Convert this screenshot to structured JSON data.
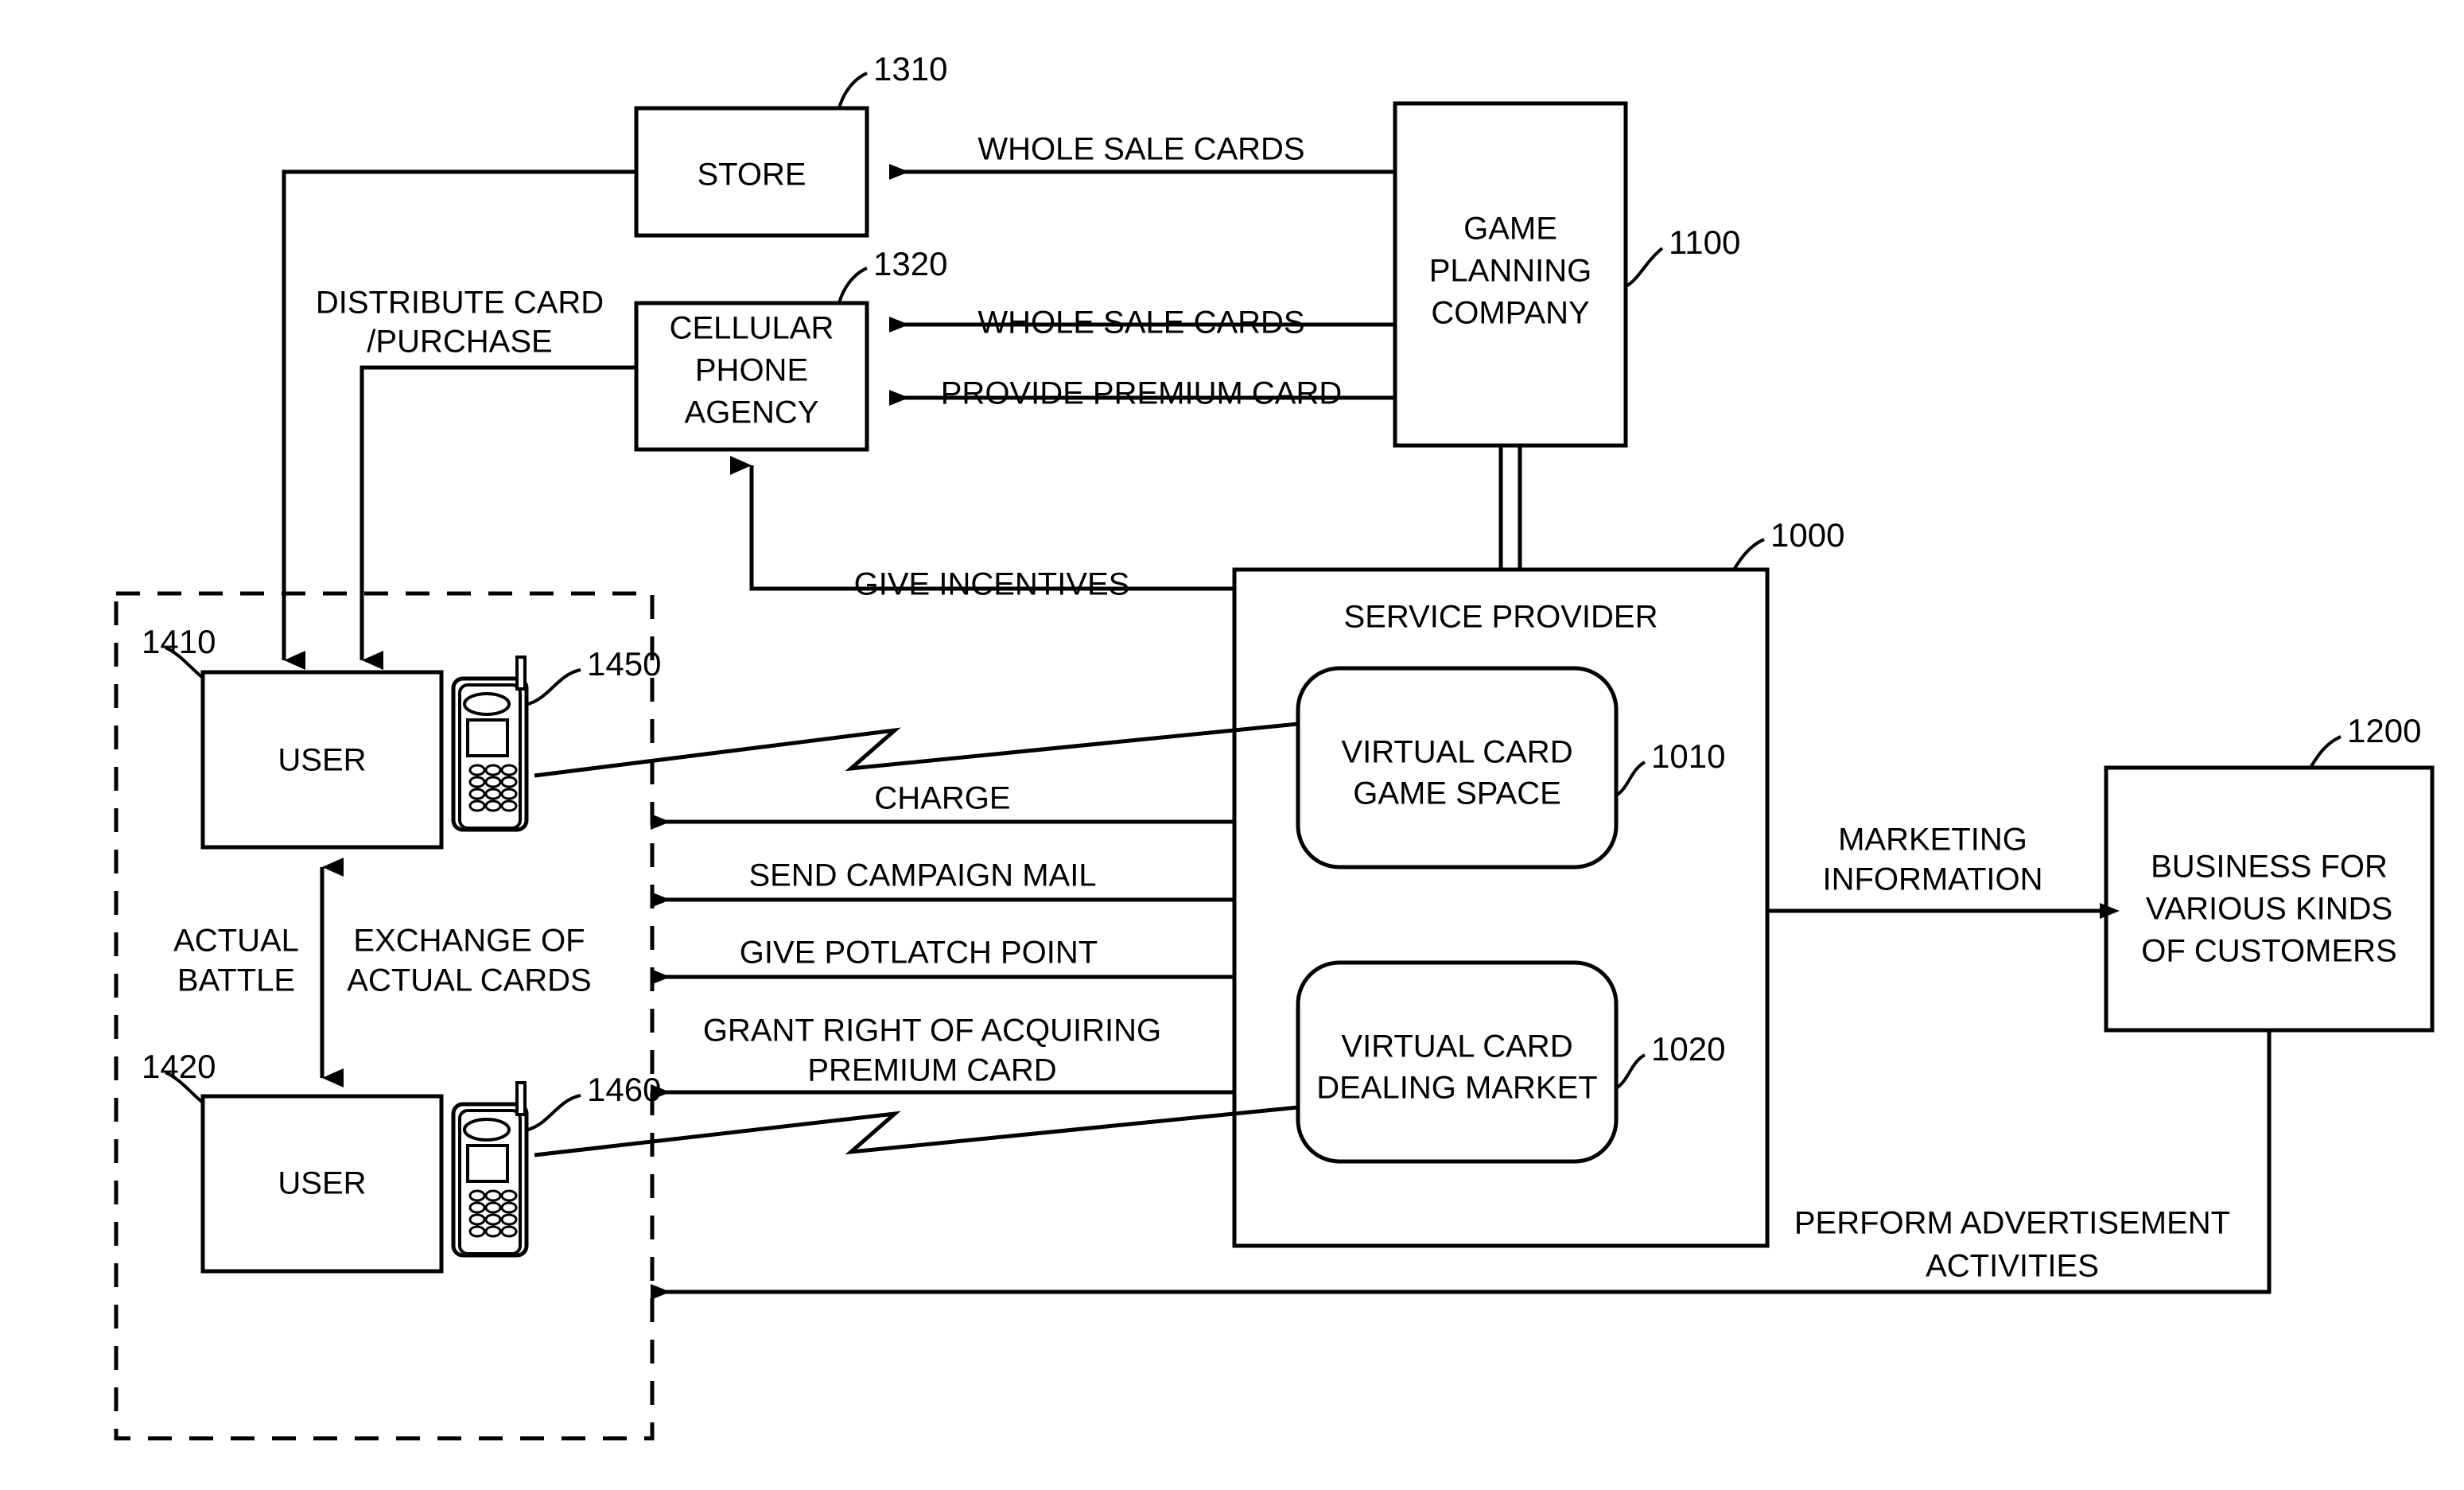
{
  "figure": {
    "type": "patent-block-diagram",
    "background": "#ffffff",
    "stroke_color": "#000000"
  },
  "boxes": {
    "store": {
      "label": "STORE",
      "ref": "1310"
    },
    "cellular_phone_agency": {
      "line1": "CELLULAR",
      "line2": "PHONE",
      "line3": "AGENCY",
      "ref": "1320"
    },
    "game_planning_company": {
      "line1": "GAME",
      "line2": "PLANNING",
      "line3": "COMPANY",
      "ref": "1100"
    },
    "service_provider": {
      "label": "SERVICE PROVIDER",
      "ref": "1000"
    },
    "virtual_card_game_space": {
      "line1": "VIRTUAL CARD",
      "line2": "GAME SPACE",
      "ref": "1010"
    },
    "virtual_card_dealing_market": {
      "line1": "VIRTUAL CARD",
      "line2": "DEALING MARKET",
      "ref": "1020"
    },
    "business_customers": {
      "line1": "BUSINESS FOR",
      "line2": "VARIOUS KINDS",
      "line3": "OF CUSTOMERS",
      "ref": "1200"
    },
    "user_top": {
      "label": "USER",
      "ref": "1410"
    },
    "user_bottom": {
      "label": "USER",
      "ref": "1420"
    },
    "phone_top": {
      "ref": "1450"
    },
    "phone_bottom": {
      "ref": "1460"
    }
  },
  "flow_labels": {
    "whole_sale_cards_store": "WHOLE SALE CARDS",
    "whole_sale_cards_agency": "WHOLE SALE CARDS",
    "provide_premium_card": "PROVIDE PREMIUM CARD",
    "distribute_card_line1": "DISTRIBUTE CARD",
    "distribute_card_line2": "/PURCHASE",
    "give_incentives": "GIVE INCENTIVES",
    "charge": "CHARGE",
    "send_campaign_mail": "SEND CAMPAIGN MAIL",
    "give_potlatch_point": "GIVE POTLATCH POINT",
    "grant_right_line1": "GRANT RIGHT OF ACQUIRING",
    "grant_right_line2": "PREMIUM CARD",
    "actual_battle_line1": "ACTUAL",
    "actual_battle_line2": "BATTLE",
    "exchange_cards_line1": "EXCHANGE OF",
    "exchange_cards_line2": "ACTUAL CARDS",
    "marketing_information_line1": "MARKETING",
    "marketing_information_line2": "INFORMATION",
    "perform_advertisement_line1": "PERFORM ADVERTISEMENT",
    "perform_advertisement_line2": "ACTIVITIES"
  }
}
